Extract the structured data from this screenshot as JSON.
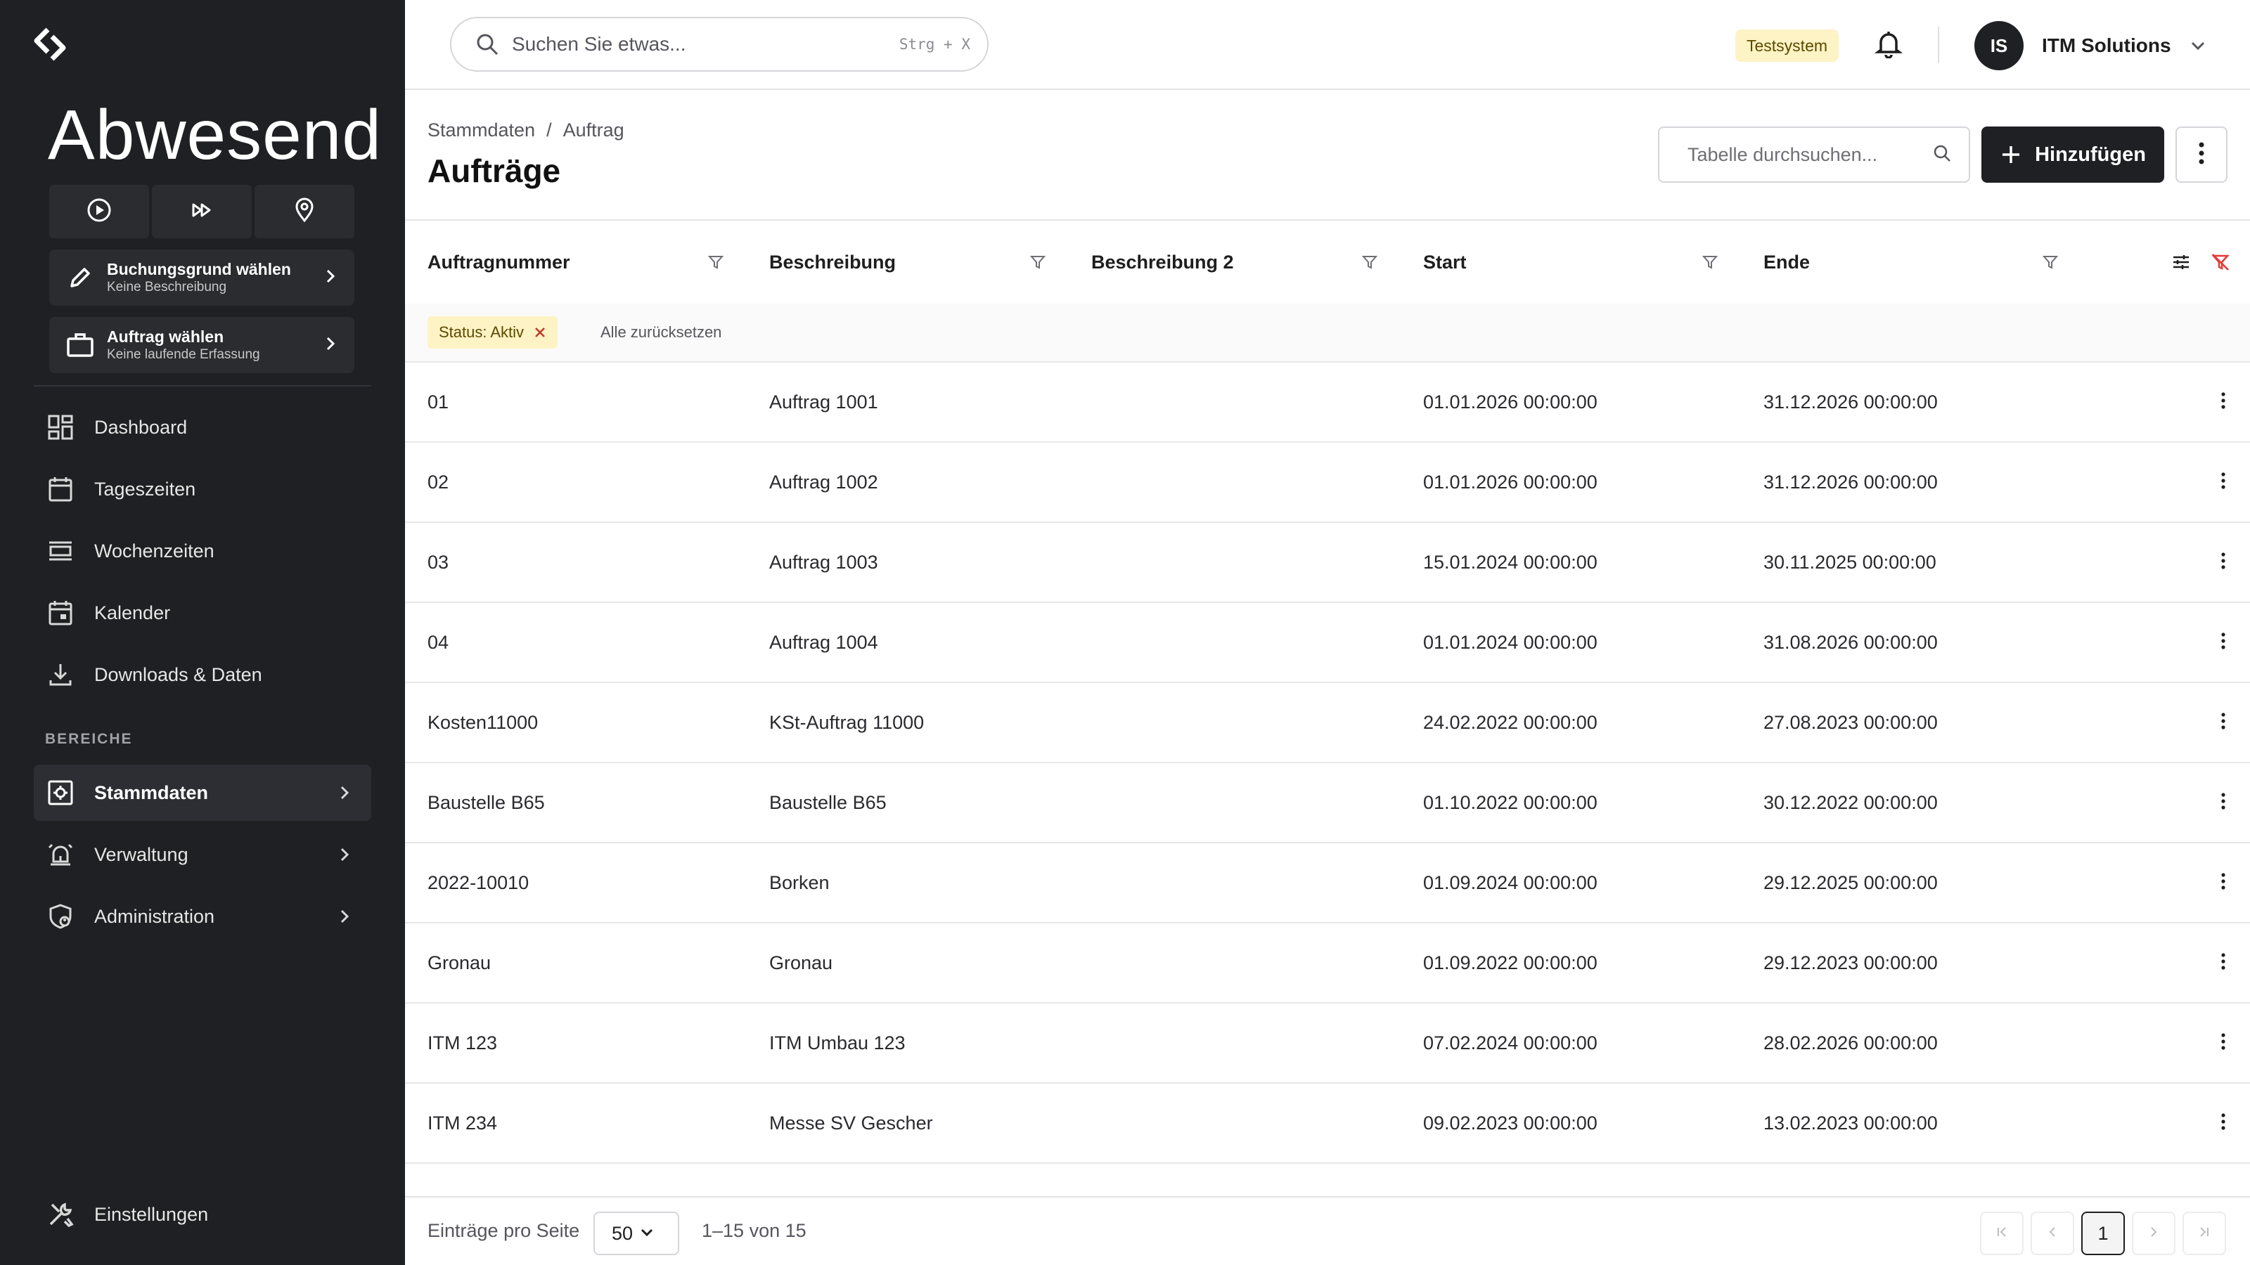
{
  "sidebar": {
    "status_title": "Abwesend",
    "actions": [
      {
        "icon": "play-circle-icon"
      },
      {
        "icon": "fast-forward-icon"
      },
      {
        "icon": "location-pin-icon"
      }
    ],
    "booking_reason": {
      "title": "Buchungsgrund wählen",
      "subtitle": "Keine Beschreibung",
      "icon": "pencil-icon"
    },
    "order": {
      "title": "Auftrag wählen",
      "subtitle": "Keine laufende Erfassung",
      "icon": "briefcase-icon"
    },
    "nav": [
      {
        "label": "Dashboard",
        "icon": "dashboard-icon"
      },
      {
        "label": "Tageszeiten",
        "icon": "calendar-day-icon"
      },
      {
        "label": "Wochenzeiten",
        "icon": "week-view-icon"
      },
      {
        "label": "Kalender",
        "icon": "calendar-icon"
      },
      {
        "label": "Downloads & Daten",
        "icon": "download-icon"
      }
    ],
    "section_label": "BEREICHE",
    "areas": [
      {
        "label": "Stammdaten",
        "icon": "master-data-icon",
        "active": true
      },
      {
        "label": "Verwaltung",
        "icon": "alarm-bell-icon",
        "active": false
      },
      {
        "label": "Administration",
        "icon": "admin-shield-icon",
        "active": false
      }
    ],
    "settings_label": "Einstellungen"
  },
  "topbar": {
    "search_placeholder": "Suchen Sie etwas...",
    "search_shortcut": "Strg + X",
    "environment_badge": "Testsystem",
    "user_initials": "IS",
    "user_name": "ITM Solutions"
  },
  "header": {
    "breadcrumb": [
      "Stammdaten",
      "Auftrag"
    ],
    "breadcrumb_separator": "/",
    "title": "Aufträge",
    "table_search_placeholder": "Tabelle durchsuchen...",
    "add_label": "Hinzufügen"
  },
  "table": {
    "columns": [
      "Auftragnummer",
      "Beschreibung",
      "Beschreibung 2",
      "Start",
      "Ende"
    ],
    "active_filter": "Status: Aktiv",
    "reset_all": "Alle zurücksetzen",
    "rows": [
      {
        "number": "01",
        "description": "Auftrag 1001",
        "description2": "",
        "start": "01.01.2026 00:00:00",
        "end": "31.12.2026 00:00:00"
      },
      {
        "number": "02",
        "description": "Auftrag 1002",
        "description2": "",
        "start": "01.01.2026 00:00:00",
        "end": "31.12.2026 00:00:00"
      },
      {
        "number": "03",
        "description": "Auftrag 1003",
        "description2": "",
        "start": "15.01.2024 00:00:00",
        "end": "30.11.2025 00:00:00"
      },
      {
        "number": "04",
        "description": "Auftrag 1004",
        "description2": "",
        "start": "01.01.2024 00:00:00",
        "end": "31.08.2026 00:00:00"
      },
      {
        "number": "Kosten11000",
        "description": "KSt-Auftrag 11000",
        "description2": "",
        "start": "24.02.2022 00:00:00",
        "end": "27.08.2023 00:00:00"
      },
      {
        "number": "Baustelle B65",
        "description": "Baustelle B65",
        "description2": "",
        "start": "01.10.2022 00:00:00",
        "end": "30.12.2022 00:00:00"
      },
      {
        "number": "2022-10010",
        "description": "Borken",
        "description2": "",
        "start": "01.09.2024 00:00:00",
        "end": "29.12.2025 00:00:00"
      },
      {
        "number": "Gronau",
        "description": "Gronau",
        "description2": "",
        "start": "01.09.2022 00:00:00",
        "end": "29.12.2023 00:00:00"
      },
      {
        "number": "ITM 123",
        "description": "ITM Umbau 123",
        "description2": "",
        "start": "07.02.2024 00:00:00",
        "end": "28.02.2026 00:00:00"
      },
      {
        "number": "ITM 234",
        "description": "Messe SV Gescher",
        "description2": "",
        "start": "09.02.2023 00:00:00",
        "end": "13.02.2023 00:00:00"
      }
    ]
  },
  "footer": {
    "per_page_label": "Einträge pro Seite",
    "per_page_value": "50",
    "range": "1–15 von 15",
    "current_page": "1"
  },
  "colors": {
    "sidebar_bg": "#1f2023",
    "primary_button": "#1f2023",
    "badge_bg": "#fdf3c4",
    "filter_clear_icon": "#e53935"
  }
}
